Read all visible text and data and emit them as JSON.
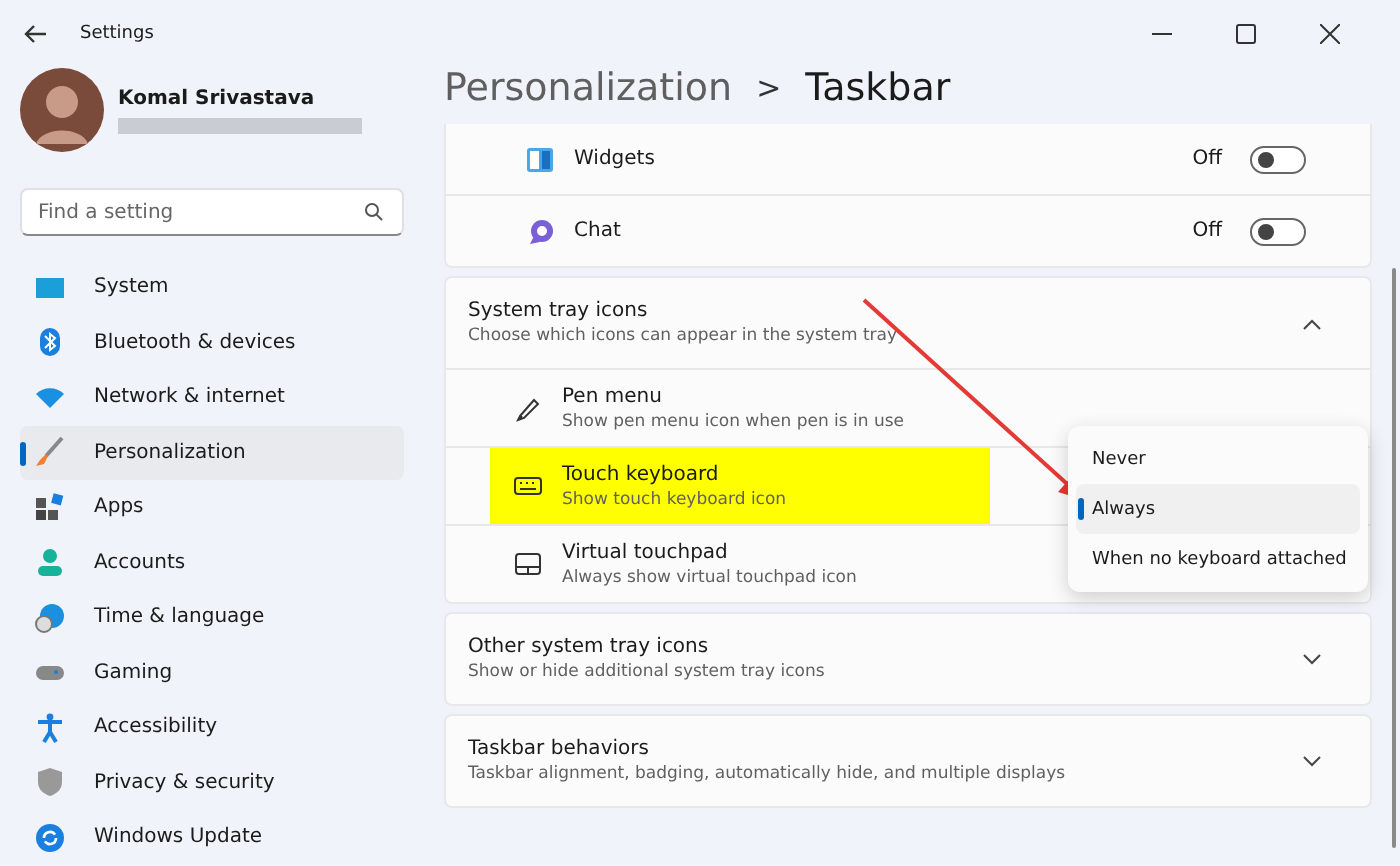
{
  "window": {
    "title": "Settings"
  },
  "user": {
    "name": "Komal Srivastava"
  },
  "search": {
    "placeholder": "Find a setting"
  },
  "sidebar": {
    "items": [
      {
        "label": "System",
        "kind": "system",
        "selected": false
      },
      {
        "label": "Bluetooth & devices",
        "kind": "bluetooth",
        "selected": false
      },
      {
        "label": "Network & internet",
        "kind": "wifi",
        "selected": false
      },
      {
        "label": "Personalization",
        "kind": "brush",
        "selected": true
      },
      {
        "label": "Apps",
        "kind": "apps",
        "selected": false
      },
      {
        "label": "Accounts",
        "kind": "person",
        "selected": false
      },
      {
        "label": "Time & language",
        "kind": "globe",
        "selected": false
      },
      {
        "label": "Gaming",
        "kind": "gamepad",
        "selected": false
      },
      {
        "label": "Accessibility",
        "kind": "access",
        "selected": false
      },
      {
        "label": "Privacy & security",
        "kind": "shield",
        "selected": false
      },
      {
        "label": "Windows Update",
        "kind": "update",
        "selected": false
      }
    ]
  },
  "breadcrumb": {
    "parent": "Personalization",
    "separator": ">",
    "current": "Taskbar"
  },
  "taskbar_items": [
    {
      "label": "Widgets",
      "kind": "widgets",
      "state": "Off",
      "on": false
    },
    {
      "label": "Chat",
      "kind": "chat",
      "state": "Off",
      "on": false
    }
  ],
  "sections": [
    {
      "title": "System tray icons",
      "subtitle": "Choose which icons can appear in the system tray",
      "expanded": true,
      "rows": [
        {
          "label": "Pen menu",
          "description": "Show pen menu icon when pen is in use",
          "kind": "pen",
          "highlighted": false
        },
        {
          "label": "Touch keyboard",
          "description": "Show touch keyboard icon",
          "kind": "keyboard",
          "highlighted": true
        },
        {
          "label": "Virtual touchpad",
          "description": "Always show virtual touchpad icon",
          "kind": "touchpad",
          "highlighted": false
        }
      ]
    },
    {
      "title": "Other system tray icons",
      "subtitle": "Show or hide additional system tray icons",
      "expanded": false
    },
    {
      "title": "Taskbar behaviors",
      "subtitle": "Taskbar alignment, badging, automatically hide, and multiple displays",
      "expanded": false
    }
  ],
  "dropdown_menu": {
    "options": [
      {
        "label": "Never",
        "selected": false
      },
      {
        "label": "Always",
        "selected": true
      },
      {
        "label": "When no keyboard attached",
        "selected": false
      }
    ]
  }
}
